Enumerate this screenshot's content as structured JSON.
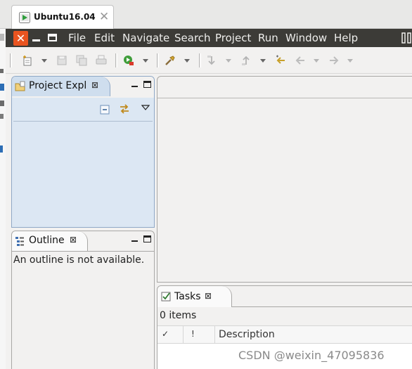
{
  "vm_tab": {
    "title": "Ubuntu16.04",
    "close_glyph": "✕",
    "icon": "vm-play-icon"
  },
  "window_controls": {
    "close_glyph": "✕"
  },
  "menu": {
    "items": [
      {
        "label": "File"
      },
      {
        "label": "Edit"
      },
      {
        "label": "Navigate"
      },
      {
        "label": "Search"
      },
      {
        "label": "Project"
      },
      {
        "label": "Run"
      },
      {
        "label": "Window"
      },
      {
        "label": "Help"
      }
    ]
  },
  "toolbar": {
    "icons": [
      "new-wizard-icon",
      "save-icon",
      "save-all-icon",
      "print-icon",
      "run-icon",
      "external-tools-icon",
      "next-annotation-icon",
      "previous-annotation-icon",
      "last-edit-location-icon",
      "back-icon",
      "forward-icon"
    ]
  },
  "project_explorer": {
    "tab_label": "Project Expl",
    "close_glyph": "⊠"
  },
  "outline": {
    "tab_label": "Outline",
    "close_glyph": "⊠",
    "message": "An outline is not available."
  },
  "tasks": {
    "tab_label": "Tasks",
    "close_glyph": "⊠",
    "count_label": "0 items",
    "columns": [
      {
        "label": "✓"
      },
      {
        "label": "!"
      },
      {
        "label": "Description"
      }
    ]
  },
  "watermark": {
    "text": "CSDN @weixin_47095836"
  },
  "colors": {
    "ubuntu_orange": "#e95420",
    "menubar": "#3c3b37",
    "selected_view_bg": "#dce7f3",
    "selected_view_border": "#8fa8c6"
  }
}
